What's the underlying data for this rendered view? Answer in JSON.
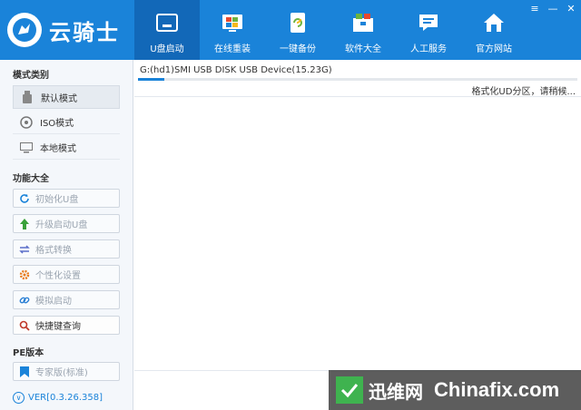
{
  "app": {
    "brand": "云骑士"
  },
  "nav": [
    {
      "label": "U盘启动",
      "icon": "usb-drive-icon",
      "active": true
    },
    {
      "label": "在线重装",
      "icon": "windows-icon",
      "active": false
    },
    {
      "label": "一键备份",
      "icon": "backup-refresh-icon",
      "active": false
    },
    {
      "label": "软件大全",
      "icon": "software-box-icon",
      "active": false
    },
    {
      "label": "人工服务",
      "icon": "chat-bubble-icon",
      "active": false
    },
    {
      "label": "官方网站",
      "icon": "home-icon",
      "active": false
    }
  ],
  "sidebar": {
    "mode_title": "模式类别",
    "modes": [
      {
        "label": "默认模式",
        "icon": "usb-stick-icon",
        "selected": true
      },
      {
        "label": "ISO模式",
        "icon": "disc-icon",
        "selected": false
      },
      {
        "label": "本地模式",
        "icon": "monitor-icon",
        "selected": false
      }
    ],
    "function_title": "功能大全",
    "functions": [
      {
        "label": "初始化U盘",
        "icon": "refresh-icon",
        "enabled": false
      },
      {
        "label": "升级启动U盘",
        "icon": "arrow-up-icon",
        "enabled": false
      },
      {
        "label": "格式转换",
        "icon": "convert-arrows-icon",
        "enabled": false
      },
      {
        "label": "个性化设置",
        "icon": "gear-icon",
        "enabled": false
      },
      {
        "label": "模拟启动",
        "icon": "link-icon",
        "enabled": false
      },
      {
        "label": "快捷键查询",
        "icon": "search-icon",
        "enabled": true
      }
    ],
    "pe_title": "PE版本",
    "pe_button": {
      "label": "专家版(标准)",
      "icon": "bookmark-icon",
      "enabled": false
    },
    "version": "VER[0.3.26.358]"
  },
  "main": {
    "device": "G:(hd1)SMI USB DISK USB Device(15.23G)",
    "progress": 0.06,
    "status": "格式化UD分区，请稍候..."
  },
  "watermark": {
    "cn": "迅维网",
    "en": "Chinafix.com"
  },
  "colors": {
    "header": "#1a83d9",
    "nav_active": "#1268b8",
    "accent": "#1a83d9"
  }
}
